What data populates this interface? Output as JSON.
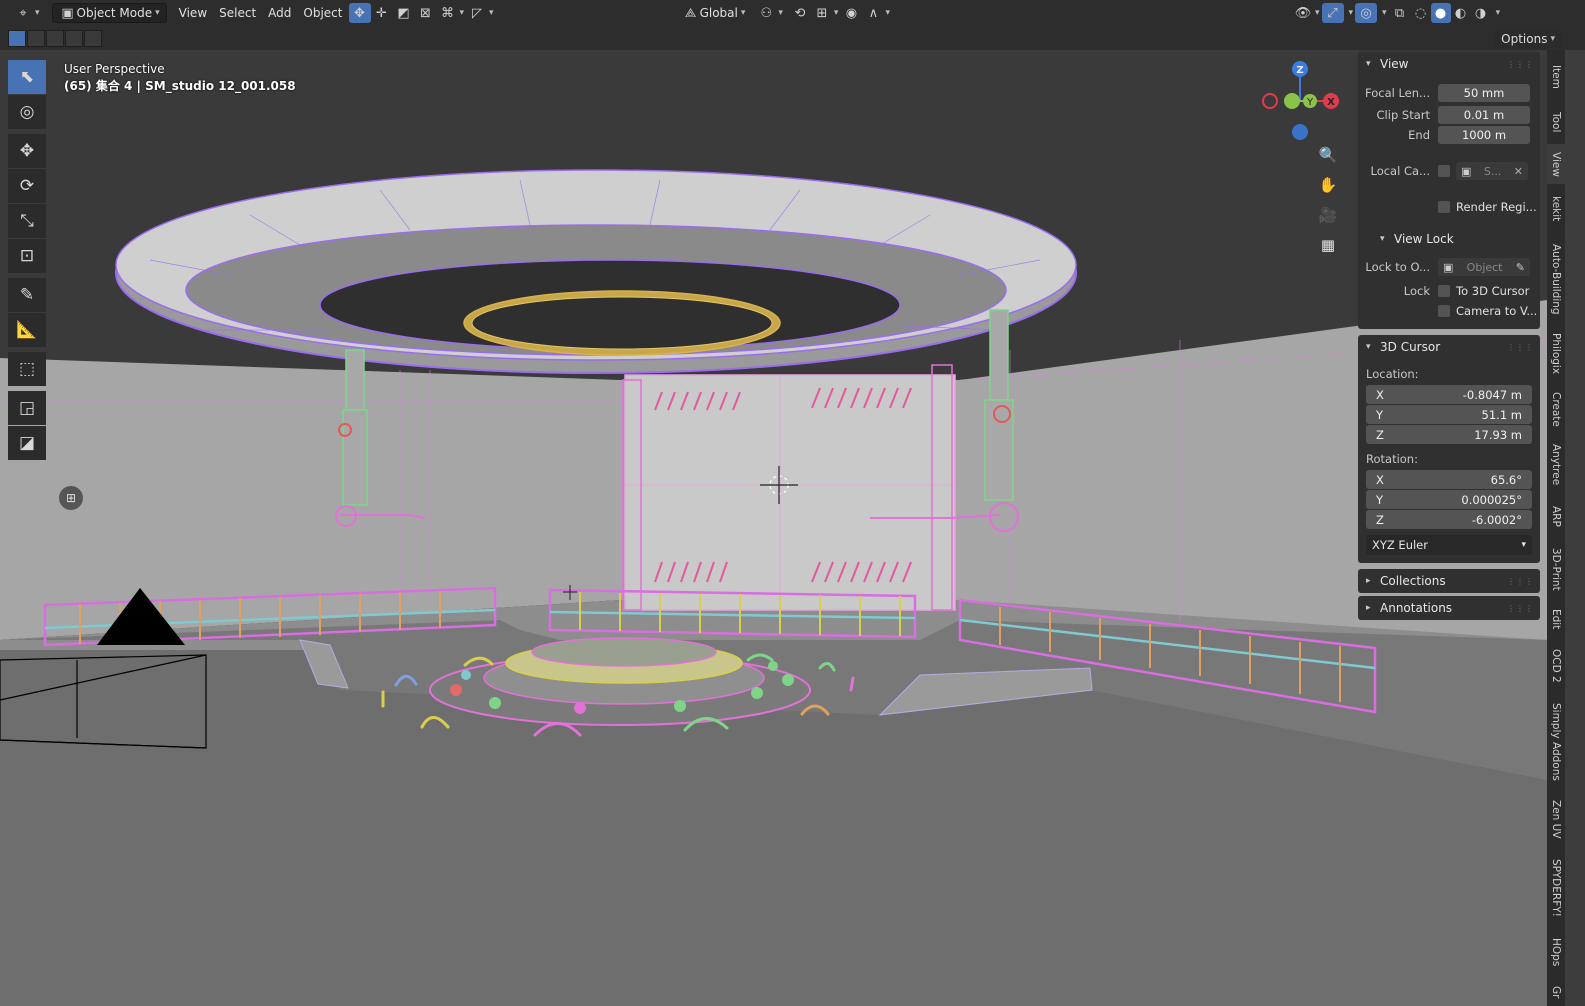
{
  "header": {
    "mode": "Object Mode",
    "menus": [
      "View",
      "Select",
      "Add",
      "Object"
    ],
    "orientation": "Global"
  },
  "subbar": {
    "options": "Options"
  },
  "viewport": {
    "perspective": "User Perspective",
    "collection_info": "(65) 集合 4 | SM_studio 12_001.058",
    "gizmo_axes": {
      "x": "X",
      "y": "Y",
      "z": "Z"
    }
  },
  "view_panel": {
    "title": "View",
    "focal_length_label": "Focal Len...",
    "focal_length": "50 mm",
    "clip_start_label": "Clip Start",
    "clip_start": "0.01 m",
    "clip_end_label": "End",
    "clip_end": "1000 m",
    "local_camera_label": "Local Ca...",
    "local_camera_value": "S...",
    "render_region_label": "Render Regi...",
    "view_lock_title": "View Lock",
    "lock_to_object_label": "Lock to O...",
    "lock_to_object_placeholder": "Object",
    "lock_label": "Lock",
    "lock_cursor_label": "To 3D Cursor",
    "lock_camera_label": "Camera to V..."
  },
  "cursor_panel": {
    "title": "3D Cursor",
    "location_label": "Location:",
    "location": {
      "x": "-0.8047 m",
      "y": "51.1 m",
      "z": "17.93 m"
    },
    "rotation_label": "Rotation:",
    "rotation": {
      "x": "65.6°",
      "y": "0.000025°",
      "z": "-6.0002°"
    },
    "axis_labels": {
      "x": "X",
      "y": "Y",
      "z": "Z"
    },
    "rotation_mode": "XYZ Euler"
  },
  "collapsed_panels": {
    "collections": "Collections",
    "annotations": "Annotations"
  },
  "tabs": [
    "Item",
    "Tool",
    "View",
    "kekit",
    "Auto-Building",
    "Philogix",
    "Create",
    "Anytree",
    "ARP",
    "3D-Print",
    "Edit",
    "OCD 2",
    "Simply Addons",
    "Zen UV",
    "SPYDERFY!",
    "HOps",
    "Gr"
  ],
  "colors": {
    "accent": "#4772b3",
    "axis_x": "#e33b4e",
    "axis_y": "#8bc34a",
    "axis_z": "#3b7ce3",
    "wire_purple": "#9b6cf0",
    "wire_pink": "#e271d8",
    "wire_gold": "#d8b24a",
    "wire_green": "#7fd48a"
  },
  "icons": [
    "editor-type-icon",
    "object-mode-icon",
    "transform-pivot-icon",
    "snap-icon",
    "proportional-icon",
    "viewport-overlay-icon",
    "shading-wireframe-icon",
    "shading-solid-icon",
    "shading-material-icon",
    "shading-rendered-icon",
    "zoom-icon",
    "pan-hand-icon",
    "camera-view-icon",
    "grid-ortho-icon"
  ]
}
